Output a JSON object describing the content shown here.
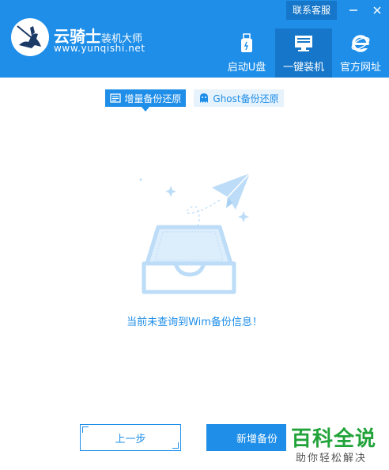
{
  "header": {
    "brand_name": "云骑士",
    "brand_suffix": "装机大师",
    "brand_url": "www.yunqishi.net",
    "top_link": "联系客服",
    "nav": [
      {
        "label": "启动U盘",
        "icon": "usb-drive-icon",
        "active": false
      },
      {
        "label": "一键装机",
        "icon": "monitor-icon",
        "active": true
      },
      {
        "label": "官方网址",
        "icon": "ie-browser-icon",
        "active": false
      }
    ]
  },
  "tabs": [
    {
      "label": "增量备份还原",
      "icon": "doc-icon",
      "active": true
    },
    {
      "label": "Ghost备份还原",
      "icon": "ghost-icon",
      "active": false
    }
  ],
  "main": {
    "message": "当前未查询到Wim备份信息！"
  },
  "buttons": {
    "prev": "上一步",
    "new_backup": "新增备份"
  },
  "watermark": {
    "title": "百科全说",
    "subtitle": "助你轻松解决"
  },
  "colors": {
    "brand_blue": "#1e8ee8",
    "active_blue": "#1676c9",
    "illustration_blue": "#bcdcf7",
    "watermark_green": "#22a33a"
  }
}
